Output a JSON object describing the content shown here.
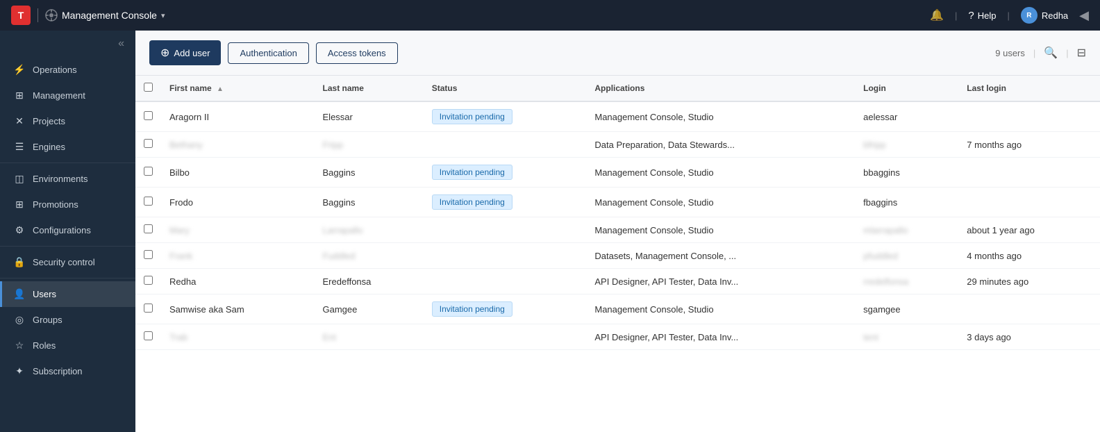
{
  "topnav": {
    "logo_text": "T",
    "app_name": "Management Console",
    "app_arrow": "▾",
    "help_label": "Help",
    "user_label": "Redha",
    "notification_icon": "🔔",
    "collapse_icon": "◀"
  },
  "sidebar": {
    "collapse_icon": "«",
    "items": [
      {
        "id": "operations",
        "label": "Operations",
        "icon": "⚡"
      },
      {
        "id": "management",
        "label": "Management",
        "icon": "⊞"
      },
      {
        "id": "projects",
        "label": "Projects",
        "icon": "✕"
      },
      {
        "id": "engines",
        "label": "Engines",
        "icon": "☰"
      },
      {
        "id": "environments",
        "label": "Environments",
        "icon": "◫"
      },
      {
        "id": "promotions",
        "label": "Promotions",
        "icon": "⊞"
      },
      {
        "id": "configurations",
        "label": "Configurations",
        "icon": "⚙"
      },
      {
        "id": "security-control",
        "label": "Security control",
        "icon": "🔒"
      },
      {
        "id": "users",
        "label": "Users",
        "icon": "👤",
        "active": true
      },
      {
        "id": "groups",
        "label": "Groups",
        "icon": "◎"
      },
      {
        "id": "roles",
        "label": "Roles",
        "icon": "☆"
      },
      {
        "id": "subscription",
        "label": "Subscription",
        "icon": "✦"
      }
    ]
  },
  "toolbar": {
    "add_user_label": "Add user",
    "authentication_label": "Authentication",
    "access_tokens_label": "Access tokens",
    "user_count": "9 users"
  },
  "table": {
    "columns": [
      {
        "id": "first_name",
        "label": "First name",
        "sortable": true
      },
      {
        "id": "last_name",
        "label": "Last name"
      },
      {
        "id": "status",
        "label": "Status"
      },
      {
        "id": "applications",
        "label": "Applications"
      },
      {
        "id": "login",
        "label": "Login"
      },
      {
        "id": "last_login",
        "label": "Last login"
      }
    ],
    "rows": [
      {
        "first_name": "Aragorn II",
        "last_name": "Elessar",
        "status": "Invitation pending",
        "applications": "Management Console, Studio",
        "login": "aelessar",
        "last_login": "",
        "blurred": false
      },
      {
        "first_name": "Bethany",
        "last_name": "Fripp",
        "status": "",
        "applications": "Data Preparation, Data Stewards...",
        "login": "bfripp",
        "last_login": "7 months ago",
        "blurred": true
      },
      {
        "first_name": "Bilbo",
        "last_name": "Baggins",
        "status": "Invitation pending",
        "applications": "Management Console, Studio",
        "login": "bbaggins",
        "last_login": "",
        "blurred": false
      },
      {
        "first_name": "Frodo",
        "last_name": "Baggins",
        "status": "Invitation pending",
        "applications": "Management Console, Studio",
        "login": "fbaggins",
        "last_login": "",
        "blurred": false
      },
      {
        "first_name": "Mary",
        "last_name": "Larrapallo",
        "status": "",
        "applications": "Management Console, Studio",
        "login": "mlarrapallo",
        "last_login": "about 1 year ago",
        "blurred": true
      },
      {
        "first_name": "Frank",
        "last_name": "Fuddled",
        "status": "",
        "applications": "Datasets, Management Console, ...",
        "login": "pfuddled",
        "last_login": "4 months ago",
        "blurred": true
      },
      {
        "first_name": "Redha",
        "last_name": "Eredeffonsa",
        "status": "",
        "applications": "API Designer, API Tester, Data Inv...",
        "login": "rredelfonsa",
        "last_login": "29 minutes ago",
        "blurred_last": true,
        "blurred": false
      },
      {
        "first_name": "Samwise aka Sam",
        "last_name": "Gamgee",
        "status": "Invitation pending",
        "applications": "Management Console, Studio",
        "login": "sgamgee",
        "last_login": "",
        "blurred": false
      },
      {
        "first_name": "Trab",
        "last_name": "Ent",
        "status": "",
        "applications": "API Designer, API Tester, Data Inv...",
        "login": "tent",
        "last_login": "3 days ago",
        "blurred": true
      }
    ]
  }
}
